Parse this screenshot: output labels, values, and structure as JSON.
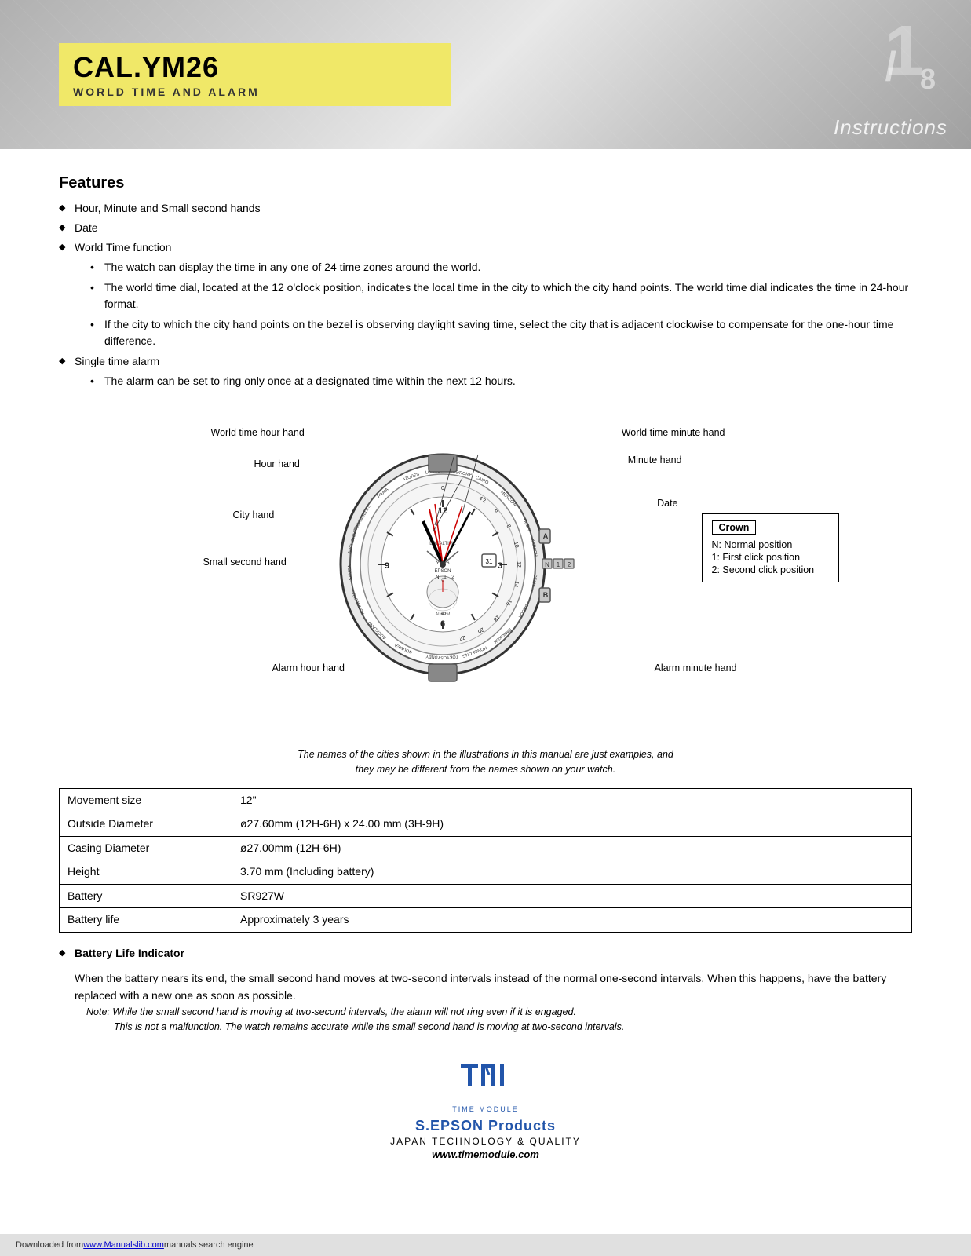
{
  "header": {
    "title_main": "CAL.YM26",
    "title_sub": "WORLD TIME AND ALARM",
    "page_num_big": "1",
    "page_num_denom": "8",
    "instructions_label": "Instructions"
  },
  "features": {
    "section_title": "Features",
    "items": [
      {
        "text": "Hour, Minute and Small second hands",
        "sub_items": []
      },
      {
        "text": "Date",
        "sub_items": []
      },
      {
        "text": "World Time function",
        "sub_items": [
          "The watch can display the time in any one of 24 time zones around the world.",
          "The world time dial, located at the 12 o'clock position, indicates the local time in the city to which the city hand points. The world time dial indicates the time in 24-hour format.",
          "If the city to which the city hand points on the bezel is observing daylight saving time, select the city that is adjacent clockwise to compensate for the one-hour time difference."
        ]
      },
      {
        "text": "Single time alarm",
        "sub_items": [
          "The alarm can be set to ring only once at a designated time within the next 12 hours."
        ]
      }
    ]
  },
  "diagram": {
    "labels": {
      "world_time_hour_hand": "World time hour hand",
      "world_time_minute_hand": "World time minute hand",
      "hour_hand": "Hour hand",
      "minute_hand": "Minute hand",
      "city_hand": "City hand",
      "date": "Date",
      "small_second_hand": "Small second hand",
      "alarm_hour_hand": "Alarm hour hand",
      "alarm_minute_hand": "Alarm minute hand"
    },
    "crown_box": {
      "title": "Crown",
      "lines": [
        "N:  Normal position",
        "1:   First click position",
        "2:   Second click position"
      ]
    },
    "italic_note_line1": "The names of the cities shown in the illustrations in this manual are just examples, and",
    "italic_note_line2": "they may be different from the names shown on your watch."
  },
  "specs": {
    "rows": [
      {
        "label": "Movement size",
        "value": "12\""
      },
      {
        "label": "Outside Diameter",
        "value": "ø27.60mm (12H-6H) x 24.00 mm (3H-9H)"
      },
      {
        "label": "Casing Diameter",
        "value": "ø27.00mm (12H-6H)"
      },
      {
        "label": "Height",
        "value": "3.70 mm (Including battery)"
      },
      {
        "label": "Battery",
        "value": "SR927W"
      },
      {
        "label": "Battery life",
        "value": "Approximately 3 years"
      }
    ]
  },
  "battery": {
    "title": "Battery Life Indicator",
    "body": "When the battery nears its end, the small second hand moves at two-second intervals instead of the normal one-second intervals. When this happens, have the battery replaced with a new one as soon as possible.",
    "note_line1": "Note:  While the small second hand is moving at two-second intervals, the alarm will not ring even if it is engaged.",
    "note_line2": "This is not a malfunction. The watch remains accurate while the small second hand is moving at two-second intervals."
  },
  "footer": {
    "tmi_label": "Tmi",
    "time_module_label": "TIME MODULE",
    "brand_label": "S.EPSON Products",
    "japan_label": "JAPAN TECHNOLOGY & QUALITY",
    "website_label": "www.timemodule.com"
  },
  "bottom_bar": {
    "downloaded_text": "Downloaded from ",
    "link_text": "www.Manualslib.com",
    "rest_text": " manuals search engine"
  }
}
